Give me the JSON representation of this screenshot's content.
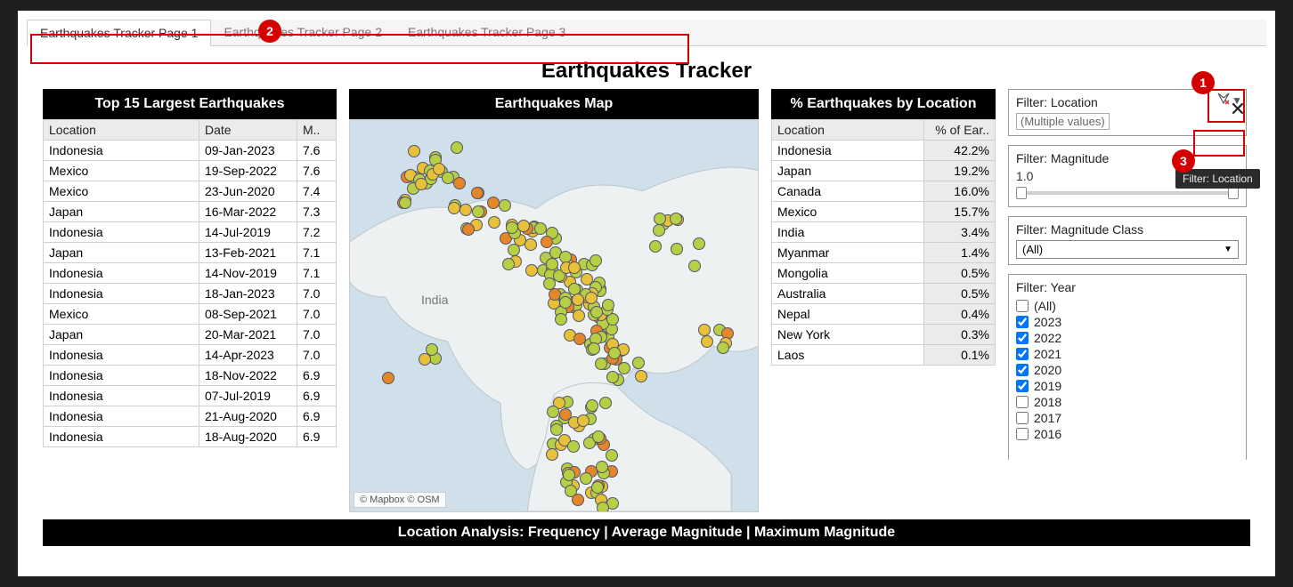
{
  "tabs": [
    "Earthquakes Tracker Page 1",
    "Earthquakes Tracker Page 2",
    "Earthquakes Tracker Page 3"
  ],
  "page_title": "Earthquakes Tracker",
  "close_label": "✕",
  "top15": {
    "title": "Top 15 Largest Earthquakes",
    "headers": [
      "Location",
      "Date",
      "M.."
    ],
    "rows": [
      {
        "location": "Indonesia",
        "date": "09-Jan-2023",
        "mag": "7.6"
      },
      {
        "location": "Mexico",
        "date": "19-Sep-2022",
        "mag": "7.6"
      },
      {
        "location": "Mexico",
        "date": "23-Jun-2020",
        "mag": "7.4"
      },
      {
        "location": "Japan",
        "date": "16-Mar-2022",
        "mag": "7.3"
      },
      {
        "location": "Indonesia",
        "date": "14-Jul-2019",
        "mag": "7.2"
      },
      {
        "location": "Japan",
        "date": "13-Feb-2021",
        "mag": "7.1"
      },
      {
        "location": "Indonesia",
        "date": "14-Nov-2019",
        "mag": "7.1"
      },
      {
        "location": "Indonesia",
        "date": "18-Jan-2023",
        "mag": "7.0"
      },
      {
        "location": "Mexico",
        "date": "08-Sep-2021",
        "mag": "7.0"
      },
      {
        "location": "Japan",
        "date": "20-Mar-2021",
        "mag": "7.0"
      },
      {
        "location": "Indonesia",
        "date": "14-Apr-2023",
        "mag": "7.0"
      },
      {
        "location": "Indonesia",
        "date": "18-Nov-2022",
        "mag": "6.9"
      },
      {
        "location": "Indonesia",
        "date": "07-Jul-2019",
        "mag": "6.9"
      },
      {
        "location": "Indonesia",
        "date": "21-Aug-2020",
        "mag": "6.9"
      },
      {
        "location": "Indonesia",
        "date": "18-Aug-2020",
        "mag": "6.9"
      }
    ]
  },
  "map": {
    "title": "Earthquakes Map",
    "label_india": "India",
    "attrib": "© Mapbox  © OSM"
  },
  "pct": {
    "title": "% Earthquakes by Location",
    "headers": [
      "Location",
      "% of Ear.."
    ],
    "rows": [
      {
        "loc": "Indonesia",
        "pct": "42.2%"
      },
      {
        "loc": "Japan",
        "pct": "19.2%"
      },
      {
        "loc": "Canada",
        "pct": "16.0%"
      },
      {
        "loc": "Mexico",
        "pct": "15.7%"
      },
      {
        "loc": "India",
        "pct": "3.4%"
      },
      {
        "loc": "Myanmar",
        "pct": "1.4%"
      },
      {
        "loc": "Mongolia",
        "pct": "0.5%"
      },
      {
        "loc": "Australia",
        "pct": "0.5%"
      },
      {
        "loc": "Nepal",
        "pct": "0.4%"
      },
      {
        "loc": "New York",
        "pct": "0.3%"
      },
      {
        "loc": "Laos",
        "pct": "0.1%"
      }
    ]
  },
  "filters": {
    "location": {
      "title": "Filter: Location",
      "value": "(Multiple values)",
      "tooltip": "Filter: Location"
    },
    "magnitude": {
      "title": "Filter: Magnitude",
      "min": "1.0",
      "max": "8.3"
    },
    "magclass": {
      "title": "Filter: Magnitude Class",
      "value": "(All)"
    },
    "year": {
      "title": "Filter: Year",
      "options": [
        {
          "label": "(All)",
          "checked": false
        },
        {
          "label": "2023",
          "checked": true
        },
        {
          "label": "2022",
          "checked": true
        },
        {
          "label": "2021",
          "checked": true
        },
        {
          "label": "2020",
          "checked": true
        },
        {
          "label": "2019",
          "checked": true
        },
        {
          "label": "2018",
          "checked": false
        },
        {
          "label": "2017",
          "checked": false
        },
        {
          "label": "2016",
          "checked": false
        }
      ]
    }
  },
  "bottom_title": "Location Analysis: Frequency | Average Magnitude | Maximum Magnitude",
  "annotations": {
    "n1": "1",
    "n2": "2",
    "n3": "3"
  }
}
